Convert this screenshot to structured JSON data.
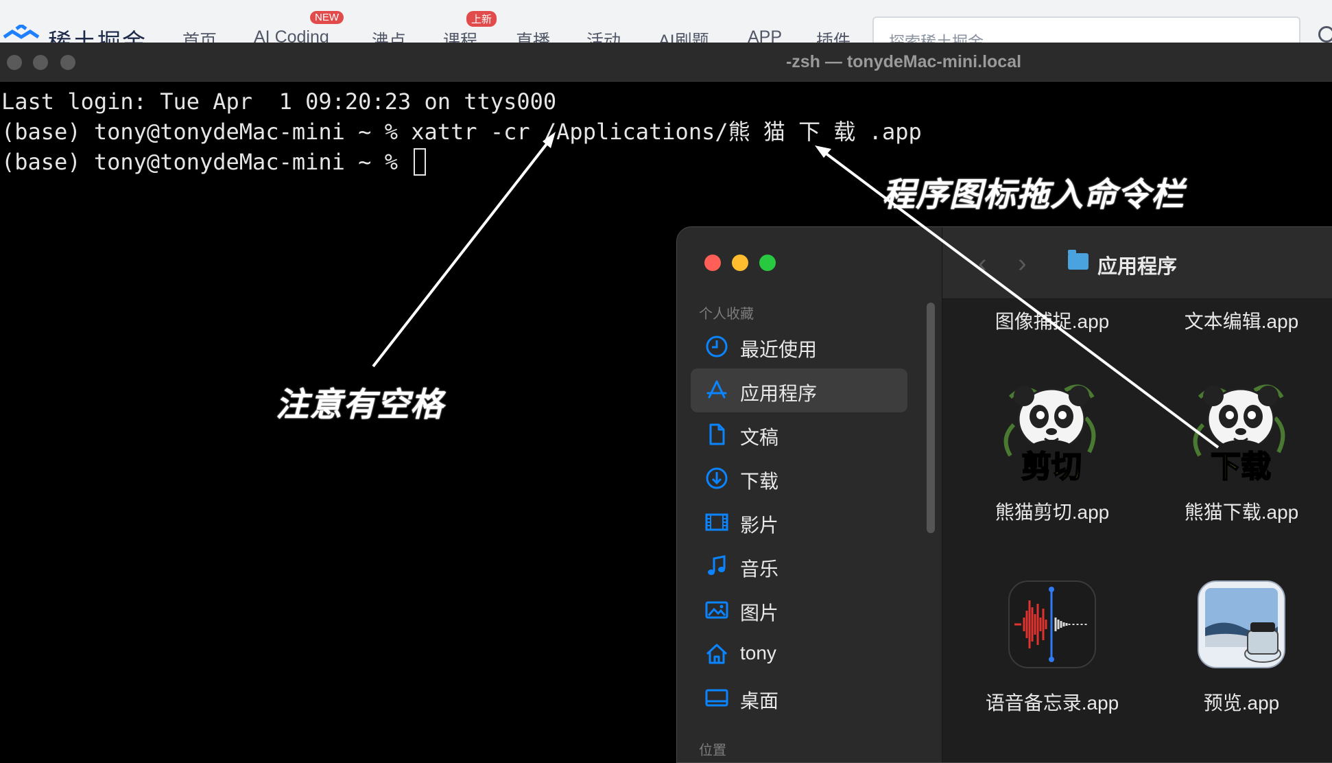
{
  "browser": {
    "brand": "稀土掘金",
    "nav": [
      "首页",
      "AI Coding",
      "沸点",
      "课程",
      "直播",
      "活动",
      "AI刷题",
      "APP",
      "插件"
    ],
    "badges": {
      "ai_coding": "NEW",
      "course": "上新"
    },
    "search_placeholder": "探索稀土掘金"
  },
  "terminal": {
    "title": "-zsh — tonydeMac-mini.local",
    "lines": [
      "Last login: Tue Apr  1 09:20:23 on ttys000",
      "(base) tony@tonydeMac-mini ~ % xattr -cr /Applications/熊 猫 下 载 .app",
      "(base) tony@tonydeMac-mini ~ % "
    ]
  },
  "finder": {
    "title": "应用程序",
    "sidebar": {
      "section_label": "个人收藏",
      "items": [
        {
          "label": "最近使用",
          "icon": "clock-icon"
        },
        {
          "label": "应用程序",
          "icon": "app-store-icon"
        },
        {
          "label": "文稿",
          "icon": "document-icon"
        },
        {
          "label": "下载",
          "icon": "download-icon"
        },
        {
          "label": "影片",
          "icon": "film-icon"
        },
        {
          "label": "音乐",
          "icon": "music-icon"
        },
        {
          "label": "图片",
          "icon": "photo-icon"
        },
        {
          "label": "tony",
          "icon": "home-icon"
        },
        {
          "label": "桌面",
          "icon": "desktop-icon"
        }
      ],
      "section_label_2": "位置"
    },
    "apps": [
      {
        "name": "图像捕捉.app"
      },
      {
        "name": "文本编辑.app"
      },
      {
        "name": "熊猫剪切.app",
        "icon_text": "剪切"
      },
      {
        "name": "熊猫下载.app",
        "icon_text": "下载"
      },
      {
        "name": "语音备忘录.app"
      },
      {
        "name": "预览.app"
      }
    ]
  },
  "annotations": {
    "note_space": "注意有空格",
    "note_drag": "程序图标拖入命令栏"
  },
  "colors": {
    "accent": "#0a84ff",
    "close": "#ff5f57",
    "minimize": "#febc2e",
    "zoom": "#28c840",
    "panda_text": "#f5e21a"
  }
}
